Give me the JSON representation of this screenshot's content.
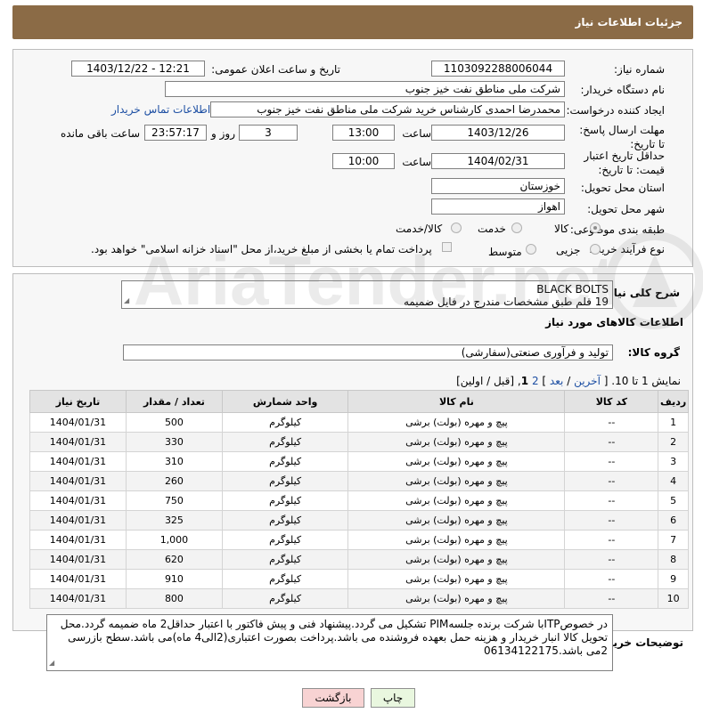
{
  "header": {
    "title": "جزئیات اطلاعات نیاز"
  },
  "form": {
    "need_number_label": "شماره نیاز:",
    "need_number": "1103092288006044",
    "announce_label": "تاریخ و ساعت اعلان عمومی:",
    "announce_value": "1403/12/22 - 12:21",
    "buyer_org_label": "نام دستگاه خریدار:",
    "buyer_org": "شرکت ملی مناطق نفت خیز جنوب",
    "creator_label": "ایجاد کننده درخواست:",
    "creator": "محمدرضا احمدی  کارشناس خرید  شرکت ملی مناطق نفت خیز جنوب",
    "contact_link": "اطلاعات تماس خریدار",
    "deadline_label": "مهلت ارسال پاسخ: تا تاریخ:",
    "deadline_date": "1403/12/26",
    "time_word": "ساعت",
    "deadline_time": "13:00",
    "days_value": "3",
    "days_word": "روز و",
    "remaining_time": "23:57:17",
    "remaining_word": "ساعت باقی مانده",
    "validity_label": "حداقل تاریخ اعتبار قیمت: تا تاریخ:",
    "validity_date": "1404/02/31",
    "validity_time": "10:00",
    "province_label": "استان محل تحویل:",
    "province": "خوزستان",
    "city_label": "شهر محل تحویل:",
    "city": "اهواز",
    "category_label": "طبقه بندی موضوعی:",
    "category_options": [
      "کالا",
      "خدمت",
      "کالا/خدمت"
    ],
    "process_label": "نوع فرآیند خرید :",
    "process_options": [
      "جزیی",
      "متوسط"
    ],
    "payment_note": "پرداخت تمام یا بخشی از مبلغ خرید،از محل \"اسناد خزانه اسلامی\" خواهد بود."
  },
  "needs": {
    "summary_label": "شرح کلی نیاز:",
    "summary_line1": "BLACK BOLTS",
    "summary_line2": "19 قلم طبق مشخصات مندرج در فایل ضمیمه",
    "goods_title": "اطلاعات کالاهای مورد نیاز",
    "group_label": "گروه کالا:",
    "group_value": "تولید و فرآوری صنعتی(سفارشی)",
    "pagination": {
      "prefix": "نمایش 1 تا 10. [",
      "last": "آخرین",
      "next": "بعد",
      "page2": "2",
      "current": "1",
      "suffix": "[قبل / اولین]"
    }
  },
  "table": {
    "headers": [
      "ردیف",
      "کد کالا",
      "نام کالا",
      "واحد شمارش",
      "تعداد / مقدار",
      "تاریخ نیاز"
    ],
    "rows": [
      [
        "1",
        "--",
        "پیچ و مهره (بولت) برشی",
        "کیلوگرم",
        "500",
        "1404/01/31"
      ],
      [
        "2",
        "--",
        "پیچ و مهره (بولت) برشی",
        "کیلوگرم",
        "330",
        "1404/01/31"
      ],
      [
        "3",
        "--",
        "پیچ و مهره (بولت) برشی",
        "کیلوگرم",
        "310",
        "1404/01/31"
      ],
      [
        "4",
        "--",
        "پیچ و مهره (بولت) برشی",
        "کیلوگرم",
        "260",
        "1404/01/31"
      ],
      [
        "5",
        "--",
        "پیچ و مهره (بولت) برشی",
        "کیلوگرم",
        "750",
        "1404/01/31"
      ],
      [
        "6",
        "--",
        "پیچ و مهره (بولت) برشی",
        "کیلوگرم",
        "325",
        "1404/01/31"
      ],
      [
        "7",
        "--",
        "پیچ و مهره (بولت) برشی",
        "کیلوگرم",
        "1,000",
        "1404/01/31"
      ],
      [
        "8",
        "--",
        "پیچ و مهره (بولت) برشی",
        "کیلوگرم",
        "620",
        "1404/01/31"
      ],
      [
        "9",
        "--",
        "پیچ و مهره (بولت) برشی",
        "کیلوگرم",
        "910",
        "1404/01/31"
      ],
      [
        "10",
        "--",
        "پیچ و مهره (بولت) برشی",
        "کیلوگرم",
        "800",
        "1404/01/31"
      ]
    ]
  },
  "buyer_notes": {
    "label": "توضیحات خریدار:",
    "text": "در خصوصITPبا شرکت برنده جلسهPIM تشکیل می گردد.پیشنهاد فنی و پیش فاکتور با اعتبار حداقل2 ماه ضمیمه گردد.محل تحویل کالا انبار خریدار و هزینه حمل بعهده فروشنده می باشد.پرداخت بصورت اعتباری(2الی4 ماه)می باشد.سطح بازرسی 2می باشد.06134122175"
  },
  "buttons": {
    "print": "چاپ",
    "back": "بازگشت"
  },
  "watermark": {
    "text": "AriaTender.net"
  },
  "colors": {
    "header_bg": "#8b6b46",
    "link": "#1d4fa3",
    "back_button": "#f8d3d3",
    "print_button": "#e9f7df"
  }
}
